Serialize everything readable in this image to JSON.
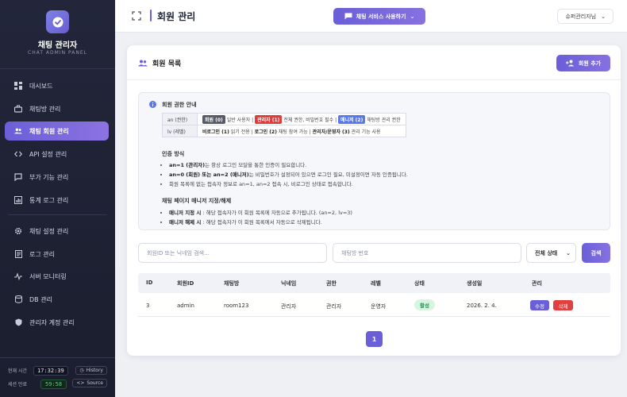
{
  "sidebar": {
    "title": "채팅 관리자",
    "subtitle": "CHAT ADMIN PANEL",
    "items": [
      {
        "label": "대시보드",
        "icon": "dashboard-icon"
      },
      {
        "label": "채팅방 관리",
        "icon": "briefcase-icon"
      },
      {
        "label": "채팅 회원 관리",
        "icon": "users-icon",
        "active": true
      },
      {
        "label": "API 설정 관리",
        "icon": "code-icon"
      },
      {
        "label": "부가 기능 관리",
        "icon": "chat-bubble-icon"
      },
      {
        "label": "통계 로그 관리",
        "icon": "chart-icon"
      },
      {
        "label": "채팅 설정 관리",
        "icon": "gear-icon"
      },
      {
        "label": "로그 관리",
        "icon": "document-icon"
      },
      {
        "label": "서버 모니터링",
        "icon": "pulse-icon"
      },
      {
        "label": "DB 관리",
        "icon": "database-icon"
      },
      {
        "label": "관리자 계정 관리",
        "icon": "shield-icon"
      }
    ],
    "footer": {
      "time_label": "현재 시간",
      "time_value": "17:32:39",
      "history_label": "History",
      "session_label": "세션 만료",
      "session_value": "59:58",
      "source_label": "Source"
    }
  },
  "header": {
    "title": "회원 관리",
    "use_service_label": "채팅 서비스 사용하기",
    "user_label": "슈퍼관리자님"
  },
  "card": {
    "title": "회원 목록",
    "add_label": "회원 추가"
  },
  "info": {
    "title": "회원 권한 안내",
    "an_key": "an (권한)",
    "an_tags": [
      {
        "tag": "회원 (0)",
        "desc": "일반 사용자",
        "color": "#555a66"
      },
      {
        "tag": "관리자 (1)",
        "desc": "전체 권한, 비밀번호 필수",
        "color": "#e03c3c"
      },
      {
        "tag": "매니저 (2)",
        "desc": "채팅방 관리 권한",
        "color": "#5b79e6"
      }
    ],
    "lv_key": "lv (레벨)",
    "lv_items": [
      {
        "name": "비로그인 (1)",
        "desc": "읽기 전용"
      },
      {
        "name": "로그인 (2)",
        "desc": "채팅 참여 가능"
      },
      {
        "name": "관리자/운영자 (3)",
        "desc": "관리 기능 사용"
      }
    ],
    "auth_title": "인증 방식",
    "auth_bullets": [
      {
        "strong": "an=1 (관리자)",
        "text": "는 항상 로그인 모달을 통한 인증이 필요합니다."
      },
      {
        "strong": "an=0 (회원) 또는 an=2 (매니저)",
        "text": "는 비밀번호가 설정되어 있으면 로그인 필요, 미설정이면 자동 인증됩니다."
      },
      {
        "strong": "",
        "text": "회원 목록에 없는 접속자 정보로 an=1, an=2 접속 시, 비로그인 상태로 접속합니다."
      }
    ],
    "manager_title": "채팅 페이지 매니저 지정/해제",
    "manager_bullets": [
      {
        "strong": "매니저 지정 시",
        "text": " : 해당 접속자가 이 회원 목록에 자동으로 추가됩니다. (an=2, lv=3)"
      },
      {
        "strong": "매니저 해제 시",
        "text": " : 해당 접속자가 이 회원 목록에서 자동으로 삭제됩니다."
      }
    ]
  },
  "filters": {
    "search_placeholder": "회원ID 또는 닉네임 검색...",
    "room_placeholder": "채팅방 번호",
    "status_selected": "전체 상태",
    "search_button": "검색"
  },
  "table": {
    "columns": [
      "ID",
      "회원ID",
      "채팅방",
      "닉네임",
      "권한",
      "레벨",
      "상태",
      "생성일",
      "관리"
    ],
    "rows": [
      {
        "id": "3",
        "member_id": "admin",
        "room": "room123",
        "nickname": "관리자",
        "role": "관리자",
        "level": "운영자",
        "status": "활성",
        "created": "2026. 2. 4.",
        "edit": "수정",
        "delete": "삭제"
      }
    ]
  },
  "pagination": {
    "current": "1"
  },
  "colors": {
    "accent": "#6a5fd8",
    "sidebar_bg": "#1f2233",
    "danger": "#e04040",
    "success_bg": "#d8f5e1"
  }
}
